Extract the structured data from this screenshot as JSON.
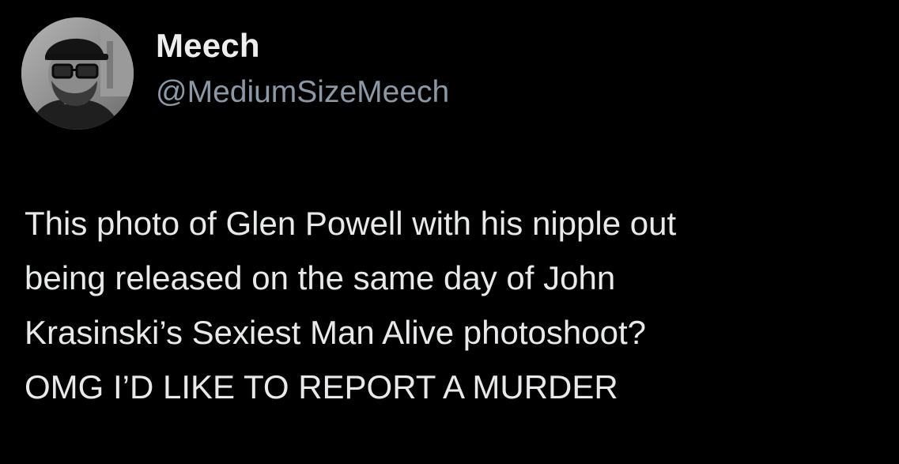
{
  "tweet": {
    "author": {
      "display_name": "Meech",
      "handle": "@MediumSizeMeech",
      "avatar_icon": "profile-photo"
    },
    "text_lines": [
      "This photo of Glen Powell with his nipple out",
      "being released on the same day of John",
      "Krasinski’s Sexiest Man Alive photoshoot?",
      "OMG I’D LIKE TO REPORT A MURDER"
    ]
  },
  "colors": {
    "background": "#000000",
    "primary_text": "#e7e9ea",
    "secondary_text": "#8b98a5"
  }
}
